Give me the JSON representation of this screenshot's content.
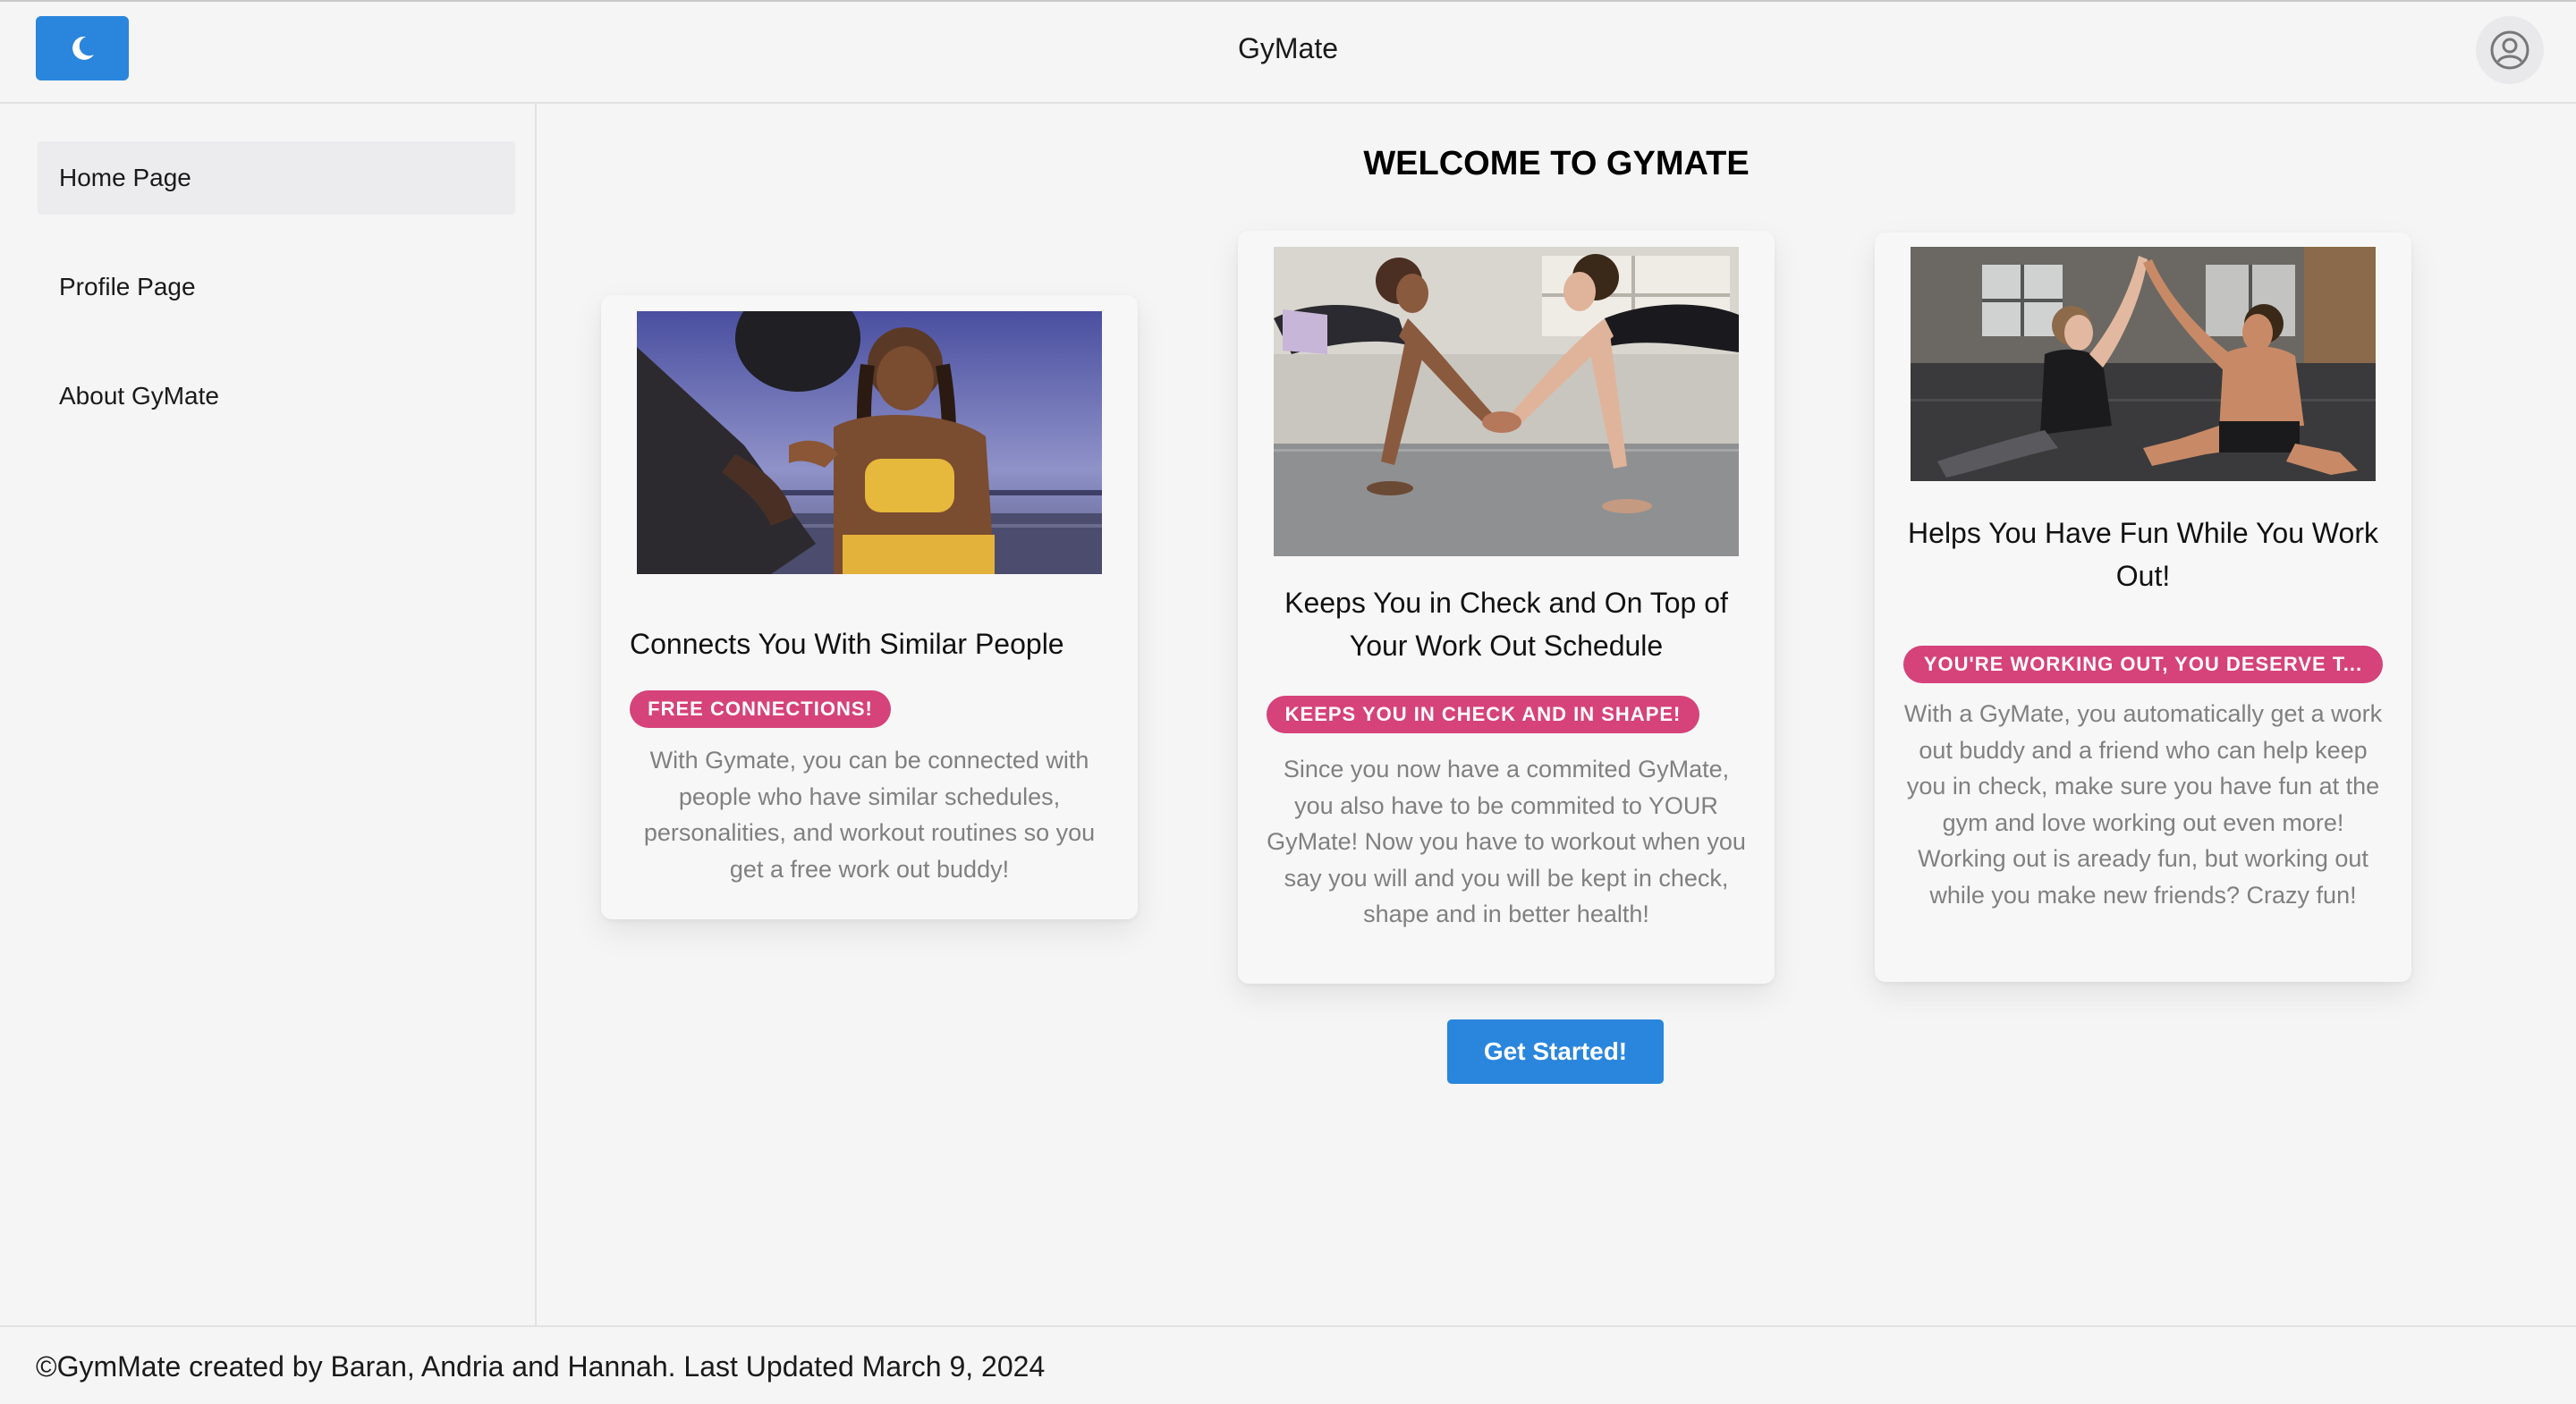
{
  "header": {
    "title": "GyMate",
    "theme_toggle_icon": "moon-icon",
    "profile_icon": "user-circle-icon"
  },
  "sidebar": {
    "items": [
      {
        "label": "Home Page",
        "active": true
      },
      {
        "label": "Profile Page",
        "active": false
      },
      {
        "label": "About GyMate",
        "active": false
      }
    ]
  },
  "main": {
    "heading": "WELCOME TO GYMATE",
    "cards": [
      {
        "title": "Connects You With Similar People",
        "badge": "FREE CONNECTIONS!",
        "description": "With Gymate, you can be connected with people who have similar schedules, personalities, and workout routines so you get a free work out buddy!",
        "image": "woman-high-five-photo"
      },
      {
        "title": "Keeps You in Check and On Top of Your Work Out Schedule",
        "badge": "KEEPS YOU IN CHECK AND IN SHAPE!",
        "description": "Since you now have a commited GyMate, you also have to be commited to YOUR GyMate! Now you have to workout when you say you will and you will be kept in check, shape and in better health!",
        "image": "plank-handshake-photo"
      },
      {
        "title": "Helps You Have Fun While You Work Out!",
        "badge": "YOU'RE WORKING OUT, YOU DESERVE T...",
        "description": "With a GyMate, you automatically get a work out buddy and a friend who can help keep you in check, make sure you have fun at the gym and love working out even more! Working out is aready fun, but working out while you make new friends? Crazy fun!",
        "image": "gym-high-five-photo"
      }
    ],
    "cta_label": "Get Started!"
  },
  "footer": {
    "text": "©GymMate created by Baran, Andria and Hannah. Last Updated March 9, 2024"
  },
  "colors": {
    "primary": "#2a86dd",
    "badge": "#d6427a",
    "background": "#f5f5f6",
    "muted_text": "#808080"
  }
}
